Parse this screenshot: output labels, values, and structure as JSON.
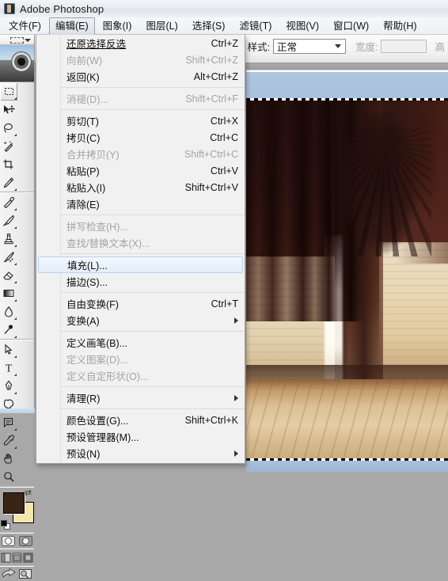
{
  "window": {
    "app_title": "Adobe Photoshop",
    "app_icon": "photoshop-icon"
  },
  "menubar": {
    "items": [
      {
        "label": "文件(F)",
        "active": false
      },
      {
        "label": "编辑(E)",
        "active": true
      },
      {
        "label": "图象(I)",
        "active": false
      },
      {
        "label": "图层(L)",
        "active": false
      },
      {
        "label": "选择(S)",
        "active": false
      },
      {
        "label": "滤镜(T)",
        "active": false
      },
      {
        "label": "视图(V)",
        "active": false
      },
      {
        "label": "窗口(W)",
        "active": false
      },
      {
        "label": "帮助(H)",
        "active": false
      }
    ]
  },
  "options_bar": {
    "style_label": "样式:",
    "style_value": "正常",
    "width_label": "宽度:",
    "width_value": "",
    "height_label": "高",
    "height_value": ""
  },
  "edit_menu": {
    "items": [
      {
        "label": "还原选择反选",
        "accel": "Ctrl+Z",
        "state": "normal"
      },
      {
        "label": "向前(W)",
        "accel": "Shift+Ctrl+Z",
        "state": "disabled"
      },
      {
        "label": "返回(K)",
        "accel": "Alt+Ctrl+Z",
        "state": "normal"
      },
      {
        "separator": true
      },
      {
        "label": "消褪(D)...",
        "accel": "Shift+Ctrl+F",
        "state": "disabled"
      },
      {
        "separator": true
      },
      {
        "label": "剪切(T)",
        "accel": "Ctrl+X",
        "state": "normal"
      },
      {
        "label": "拷贝(C)",
        "accel": "Ctrl+C",
        "state": "normal"
      },
      {
        "label": "合并拷贝(Y)",
        "accel": "Shift+Ctrl+C",
        "state": "disabled"
      },
      {
        "label": "粘贴(P)",
        "accel": "Ctrl+V",
        "state": "normal"
      },
      {
        "label": "粘贴入(I)",
        "accel": "Shift+Ctrl+V",
        "state": "normal"
      },
      {
        "label": "清除(E)",
        "accel": "",
        "state": "normal"
      },
      {
        "separator": true
      },
      {
        "label": "拼写检查(H)...",
        "accel": "",
        "state": "disabled"
      },
      {
        "label": "查找/替换文本(X)...",
        "accel": "",
        "state": "disabled"
      },
      {
        "separator": true
      },
      {
        "label": "填充(L)...",
        "accel": "",
        "state": "highlighted"
      },
      {
        "label": "描边(S)...",
        "accel": "",
        "state": "normal"
      },
      {
        "separator": true
      },
      {
        "label": "自由变换(F)",
        "accel": "Ctrl+T",
        "state": "normal"
      },
      {
        "label": "变换(A)",
        "accel": "",
        "state": "submenu"
      },
      {
        "separator": true
      },
      {
        "label": "定义画笔(B)...",
        "accel": "",
        "state": "normal"
      },
      {
        "label": "定义图案(D)...",
        "accel": "",
        "state": "disabled"
      },
      {
        "label": "定义自定形状(O)...",
        "accel": "",
        "state": "disabled"
      },
      {
        "separator": true
      },
      {
        "label": "清理(R)",
        "accel": "",
        "state": "submenu"
      },
      {
        "separator": true
      },
      {
        "label": "颜色设置(G)...",
        "accel": "Shift+Ctrl+K",
        "state": "normal"
      },
      {
        "label": "预设管理器(M)...",
        "accel": "",
        "state": "normal"
      },
      {
        "label": "预设(N)",
        "accel": "",
        "state": "submenu"
      }
    ]
  },
  "toolbox": {
    "rows": [
      [
        {
          "icon": "marquee-rectangular-icon",
          "selected": true,
          "has_flyout": true
        },
        {
          "icon": "move-tool-icon",
          "selected": false,
          "has_flyout": false
        }
      ],
      [
        {
          "icon": "lasso-tool-icon",
          "selected": false,
          "has_flyout": true
        },
        {
          "icon": "magic-wand-icon",
          "selected": false,
          "has_flyout": false
        }
      ],
      [
        {
          "icon": "crop-tool-icon",
          "selected": false,
          "has_flyout": false
        },
        {
          "icon": "slice-tool-icon",
          "selected": false,
          "has_flyout": true
        }
      ],
      [
        {
          "icon": "healing-brush-icon",
          "selected": false,
          "has_flyout": true
        },
        {
          "icon": "paintbrush-icon",
          "selected": false,
          "has_flyout": true
        }
      ],
      [
        {
          "icon": "clone-stamp-icon",
          "selected": false,
          "has_flyout": true
        },
        {
          "icon": "history-brush-icon",
          "selected": false,
          "has_flyout": true
        }
      ],
      [
        {
          "icon": "eraser-icon",
          "selected": false,
          "has_flyout": true
        },
        {
          "icon": "gradient-tool-icon",
          "selected": false,
          "has_flyout": true
        }
      ],
      [
        {
          "icon": "blur-tool-icon",
          "selected": false,
          "has_flyout": true
        },
        {
          "icon": "dodge-tool-icon",
          "selected": false,
          "has_flyout": true
        }
      ],
      [
        {
          "icon": "path-selection-icon",
          "selected": false,
          "has_flyout": true
        },
        {
          "icon": "type-tool-icon",
          "selected": false,
          "has_flyout": true
        }
      ],
      [
        {
          "icon": "pen-tool-icon",
          "selected": false,
          "has_flyout": true
        },
        {
          "icon": "custom-shape-icon",
          "selected": false,
          "has_flyout": true
        }
      ],
      [
        {
          "icon": "notes-tool-icon",
          "selected": false,
          "has_flyout": true
        },
        {
          "icon": "eyedropper-icon",
          "selected": false,
          "has_flyout": true
        }
      ],
      [
        {
          "icon": "hand-tool-icon",
          "selected": false,
          "has_flyout": false
        },
        {
          "icon": "zoom-tool-icon",
          "selected": false,
          "has_flyout": false
        }
      ]
    ],
    "colors": {
      "foreground": "#3a2416",
      "background": "#f6e6ae",
      "swap_icon": "swap-colors-icon",
      "default_icon": "default-colors-icon"
    },
    "mask_modes": [
      {
        "icon": "standard-mask-mode-icon",
        "selected": true
      },
      {
        "icon": "quick-mask-mode-icon",
        "selected": false
      }
    ],
    "screen_modes": [
      {
        "icon": "standard-screen-mode-icon",
        "selected": true
      },
      {
        "icon": "full-screen-menubar-mode-icon",
        "selected": false
      },
      {
        "icon": "full-screen-mode-icon",
        "selected": false
      }
    ],
    "jump_to": [
      {
        "icon": "jump-to-imageready-icon"
      },
      {
        "icon": "imageready-preview-icon"
      }
    ]
  },
  "document": {
    "artwork_name": "interior-room-painting",
    "selection_active": true
  }
}
